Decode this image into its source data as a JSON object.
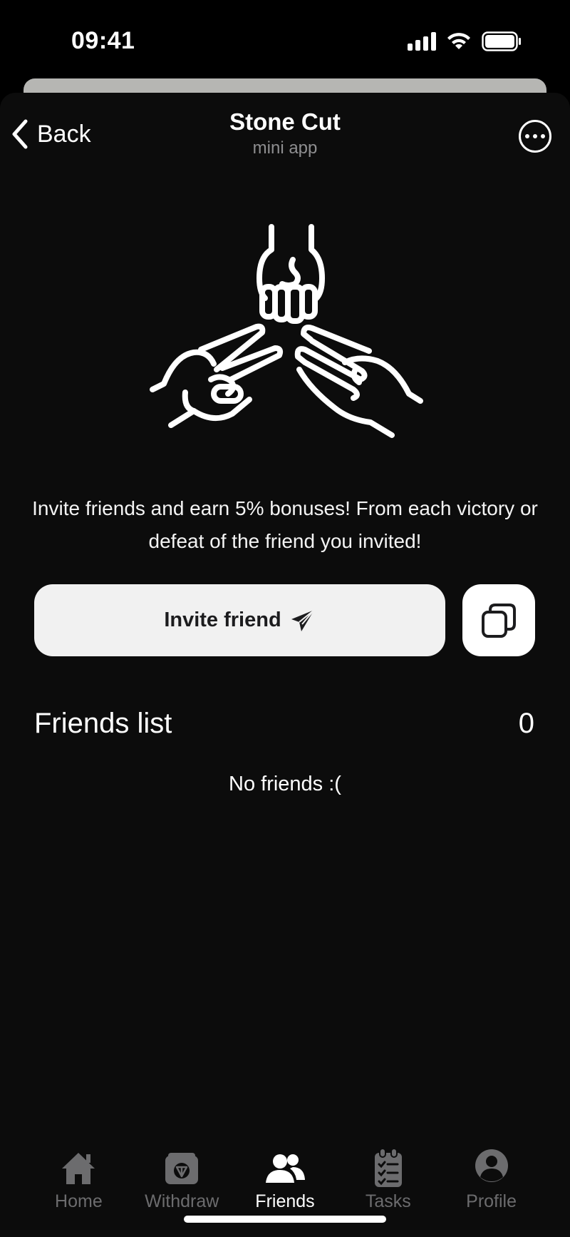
{
  "status_bar": {
    "time": "09:41"
  },
  "nav": {
    "back_label": "Back",
    "title": "Stone Cut",
    "subtitle": "mini app"
  },
  "hero": {
    "icon": "rock-paper-scissors-hands-icon"
  },
  "invite": {
    "description": "Invite friends and earn 5% bonuses! From each victory or defeat of the friend you invited!",
    "button_label": "Invite friend",
    "button_icon": "paper-plane-icon",
    "copy_icon": "copy-icon"
  },
  "friends": {
    "title": "Friends list",
    "count": "0",
    "empty_message": "No friends :("
  },
  "tabs": [
    {
      "label": "Home",
      "icon": "home-icon",
      "active": false
    },
    {
      "label": "Withdraw",
      "icon": "wallet-icon",
      "active": false
    },
    {
      "label": "Friends",
      "icon": "users-icon",
      "active": true
    },
    {
      "label": "Tasks",
      "icon": "clipboard-list-icon",
      "active": false
    },
    {
      "label": "Profile",
      "icon": "user-circle-icon",
      "active": false
    }
  ],
  "colors": {
    "background": "#0c0c0c",
    "button_bg": "#f1f1f1",
    "active_tab": "#ffffff",
    "inactive_tab": "#6c6c6e"
  }
}
